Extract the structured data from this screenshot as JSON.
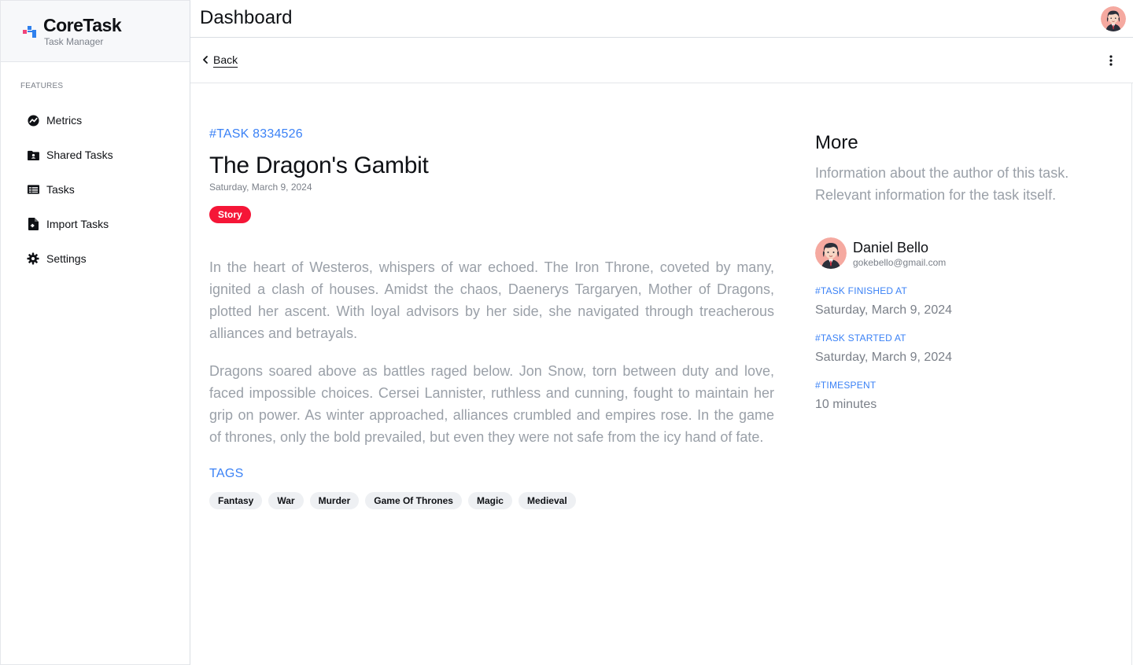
{
  "app": {
    "name": "CoreTask",
    "subtitle": "Task Manager"
  },
  "sidebar": {
    "section_label": "FEATURES",
    "items": [
      {
        "label": "Metrics",
        "icon": "metrics-icon"
      },
      {
        "label": "Shared Tasks",
        "icon": "shared-folder-icon"
      },
      {
        "label": "Tasks",
        "icon": "tasks-list-icon"
      },
      {
        "label": "Import Tasks",
        "icon": "import-file-icon"
      },
      {
        "label": "Settings",
        "icon": "gear-icon"
      }
    ]
  },
  "header": {
    "title": "Dashboard"
  },
  "subbar": {
    "back_label": "Back"
  },
  "task": {
    "id": "#TASK 8334526",
    "title": "The Dragon's Gambit",
    "date": "Saturday, March 9, 2024",
    "type_badge": "Story",
    "paragraphs": [
      "In the heart of Westeros, whispers of war echoed. The Iron Throne, coveted by many, ignited a clash of houses. Amidst the chaos, Daenerys Targaryen, Mother of Dragons, plotted her ascent. With loyal advisors by her side, she navigated through treacherous alliances and betrayals.",
      "Dragons soared above as battles raged below. Jon Snow, torn between duty and love, faced impossible choices. Cersei Lannister, ruthless and cunning, fought to maintain her grip on power. As winter approached, alliances crumbled and empires rose. In the game of thrones, only the bold prevailed, but even they were not safe from the icy hand of fate."
    ],
    "tags_label": "TAGS",
    "tags": [
      "Fantasy",
      "War",
      "Murder",
      "Game Of Thrones",
      "Magic",
      "Medieval"
    ]
  },
  "more": {
    "title": "More",
    "description": "Information about the author of this task. Relevant information for the task itself.",
    "author": {
      "name": "Daniel Bello",
      "email": "gokebello@gmail.com"
    },
    "finished_label": "#TASK FINISHED AT",
    "finished_value": "Saturday, March 9, 2024",
    "started_label": "#TASK STARTED AT",
    "started_value": "Saturday, March 9, 2024",
    "timespent_label": "#TIMESPENT",
    "timespent_value": "10 minutes"
  },
  "colors": {
    "accent": "#3b82f6",
    "story_badge": "#f51637",
    "logo_pink": "#f0457a",
    "logo_blue": "#2f80ed"
  }
}
